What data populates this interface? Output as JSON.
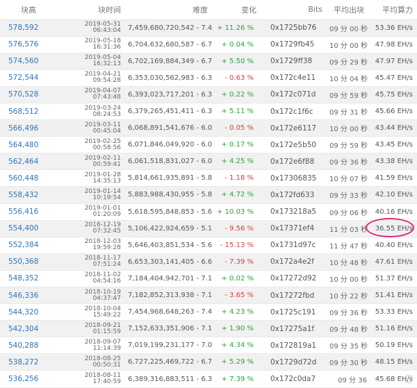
{
  "table": {
    "headers": {
      "height": "块高",
      "time": "块时间",
      "difficulty": "难度",
      "change": "变化",
      "bits": "Bits",
      "avg_time": "平均出块",
      "avg_hashrate": "平均算力"
    },
    "rows": [
      {
        "height": "578,592",
        "date": "2019-05-31",
        "time": "06:43:04",
        "difficulty": "7,459,680,720,542 - 7.46 T",
        "change": "+ 11.26 %",
        "direction": "up",
        "bits": "0x1725bb76",
        "avg_time": "09 分 00 秒",
        "hashrate": "53.36 EH/s"
      },
      {
        "height": "576,576",
        "date": "2019-05-18",
        "time": "16:31:36",
        "difficulty": "6,704,632,680,587 - 6.70 T",
        "change": "+ 0.04 %",
        "direction": "up",
        "bits": "0x1729fb45",
        "avg_time": "10 分 00 秒",
        "hashrate": "47.98 EH/s"
      },
      {
        "height": "574,560",
        "date": "2019-05-04",
        "time": "16:32:13",
        "difficulty": "6,702,169,884,349 - 6.70 T",
        "change": "+ 5.50 %",
        "direction": "up",
        "bits": "0x1729ff38",
        "avg_time": "09 分 29 秒",
        "hashrate": "47.97 EH/s"
      },
      {
        "height": "572,544",
        "date": "2019-04-21",
        "time": "09:54:28",
        "difficulty": "6,353,030,562,983 - 6.35 T",
        "change": "- 0.63 %",
        "direction": "down",
        "bits": "0x172c4e11",
        "avg_time": "10 分 04 秒",
        "hashrate": "45.47 EH/s"
      },
      {
        "height": "570,528",
        "date": "2019-04-07",
        "time": "07:43:48",
        "difficulty": "6,393,023,717,201 - 6.39 T",
        "change": "+ 0.22 %",
        "direction": "up",
        "bits": "0x172c071d",
        "avg_time": "09 分 59 秒",
        "hashrate": "45.75 EH/s"
      },
      {
        "height": "568,512",
        "date": "2019-03-24",
        "time": "08:24:53",
        "difficulty": "6,379,265,451,411 - 6.38 T",
        "change": "+ 5.11 %",
        "direction": "up",
        "bits": "0x172c1f6c",
        "avg_time": "09 分 31 秒",
        "hashrate": "45.66 EH/s"
      },
      {
        "height": "566,496",
        "date": "2019-03-11",
        "time": "00:45:04",
        "difficulty": "6,068,891,541,676 - 6.07 T",
        "change": "- 0.05 %",
        "direction": "down",
        "bits": "0x172e6117",
        "avg_time": "10 分 00 秒",
        "hashrate": "43.44 EH/s"
      },
      {
        "height": "564,480",
        "date": "2019-02-25",
        "time": "00:58:56",
        "difficulty": "6,071,846,049,920 - 6.07 T",
        "change": "+ 0.17 %",
        "direction": "up",
        "bits": "0x172e5b50",
        "avg_time": "09 分 59 秒",
        "hashrate": "43.45 EH/s"
      },
      {
        "height": "562,464",
        "date": "2019-02-11",
        "time": "00:59:41",
        "difficulty": "6,061,518,831,027 - 6.06 T",
        "change": "+ 4.25 %",
        "direction": "up",
        "bits": "0x172e6f88",
        "avg_time": "09 分 36 秒",
        "hashrate": "43.38 EH/s"
      },
      {
        "height": "560,448",
        "date": "2019-01-28",
        "time": "14:35:13",
        "difficulty": "5,814,661,935,891 - 5.81 T",
        "change": "- 1.18 %",
        "direction": "down",
        "bits": "0x17306835",
        "avg_time": "10 分 07 秒",
        "hashrate": "41.59 EH/s"
      },
      {
        "height": "558,432",
        "date": "2019-01-14",
        "time": "10:19:54",
        "difficulty": "5,883,988,430,955 - 5.88 T",
        "change": "+ 4.72 %",
        "direction": "up",
        "bits": "0x172fd633",
        "avg_time": "09 分 33 秒",
        "hashrate": "42.10 EH/s"
      },
      {
        "height": "556,416",
        "date": "2019-01-01",
        "time": "01:20:09",
        "difficulty": "5,618,595,848,853 - 5.62 T",
        "change": "+ 10.03 %",
        "direction": "up",
        "bits": "0x173218a5",
        "avg_time": "09 分 06 秒",
        "hashrate": "40.16 EH/s"
      },
      {
        "height": "554,400",
        "date": "2018-12-19",
        "time": "07:32:45",
        "difficulty": "5,106,422,924,659 - 5.11 T",
        "change": "- 9.56 %",
        "direction": "down",
        "bits": "0x17371ef4",
        "avg_time": "11 分 03 秒",
        "hashrate": "36.55 EH/s"
      },
      {
        "height": "552,384",
        "date": "2018-12-03",
        "time": "19:59:28",
        "difficulty": "5,646,403,851,534 - 5.65 T",
        "change": "- 15.13 %",
        "direction": "down",
        "bits": "0x1731d97c",
        "avg_time": "11 分 47 秒",
        "hashrate": "40.40 EH/s"
      },
      {
        "height": "550,368",
        "date": "2018-11-17",
        "time": "07:51:24",
        "difficulty": "6,653,303,141,405 - 6.65 T",
        "change": "- 7.39 %",
        "direction": "down",
        "bits": "0x172a4e2f",
        "avg_time": "10 分 48 秒",
        "hashrate": "47.61 EH/s"
      },
      {
        "height": "548,352",
        "date": "2018-11-02",
        "time": "04:54:16",
        "difficulty": "7,184,404,942,701 - 7.18 T",
        "change": "+ 0.02 %",
        "direction": "up",
        "bits": "0x17272d92",
        "avg_time": "10 分 00 秒",
        "hashrate": "51.37 EH/s"
      },
      {
        "height": "546,336",
        "date": "2018-10-19",
        "time": "04:37:47",
        "difficulty": "7,182,852,313,938 - 7.18 T",
        "change": "- 3.65 %",
        "direction": "down",
        "bits": "0x17272fbd",
        "avg_time": "10 分 22 秒",
        "hashrate": "51.41 EH/s"
      },
      {
        "height": "544,320",
        "date": "2018-10-04",
        "time": "15:49:22",
        "difficulty": "7,454,968,648,263 - 7.45 T",
        "change": "+ 4.23 %",
        "direction": "up",
        "bits": "0x1725c191",
        "avg_time": "09 分 36 秒",
        "hashrate": "53.33 EH/s"
      },
      {
        "height": "542,304",
        "date": "2018-09-21",
        "time": "01:15:59",
        "difficulty": "7,152,633,351,906 - 7.15 T",
        "change": "+ 1.90 %",
        "direction": "up",
        "bits": "0x17275a1f",
        "avg_time": "09 分 48 秒",
        "hashrate": "51.16 EH/s"
      },
      {
        "height": "540,288",
        "date": "2018-09-07",
        "time": "11:14:39",
        "difficulty": "7,019,199,231,177 - 7.02 T",
        "change": "+ 4.34 %",
        "direction": "up",
        "bits": "0x172819a1",
        "avg_time": "09 分 35 秒",
        "hashrate": "50.19 EH/s"
      },
      {
        "height": "538,272",
        "date": "2018-08-25",
        "time": "00:50:31",
        "difficulty": "6,727,225,469,722 - 6.73 T",
        "change": "+ 5.29 %",
        "direction": "up",
        "bits": "0x1729d72d",
        "avg_time": "09 分 30 秒",
        "hashrate": "48.15 EH/s"
      },
      {
        "height": "536,256",
        "date": "2018-08-11",
        "time": "17:40:59",
        "difficulty": "6,389,316,883,511 - 6.39 T",
        "change": "+ 7.39 %",
        "direction": "up",
        "bits": "0x172c0da7",
        "avg_time": "09 分 36",
        "hashrate": "45.68 EH/s"
      }
    ]
  },
  "colors": {
    "link": "#2f73b8",
    "up": "#2aa33a",
    "down": "#e03a3a",
    "highlight_circle": "#e0237a"
  },
  "watermark": {
    "icon": "watermark-logo-icon"
  }
}
